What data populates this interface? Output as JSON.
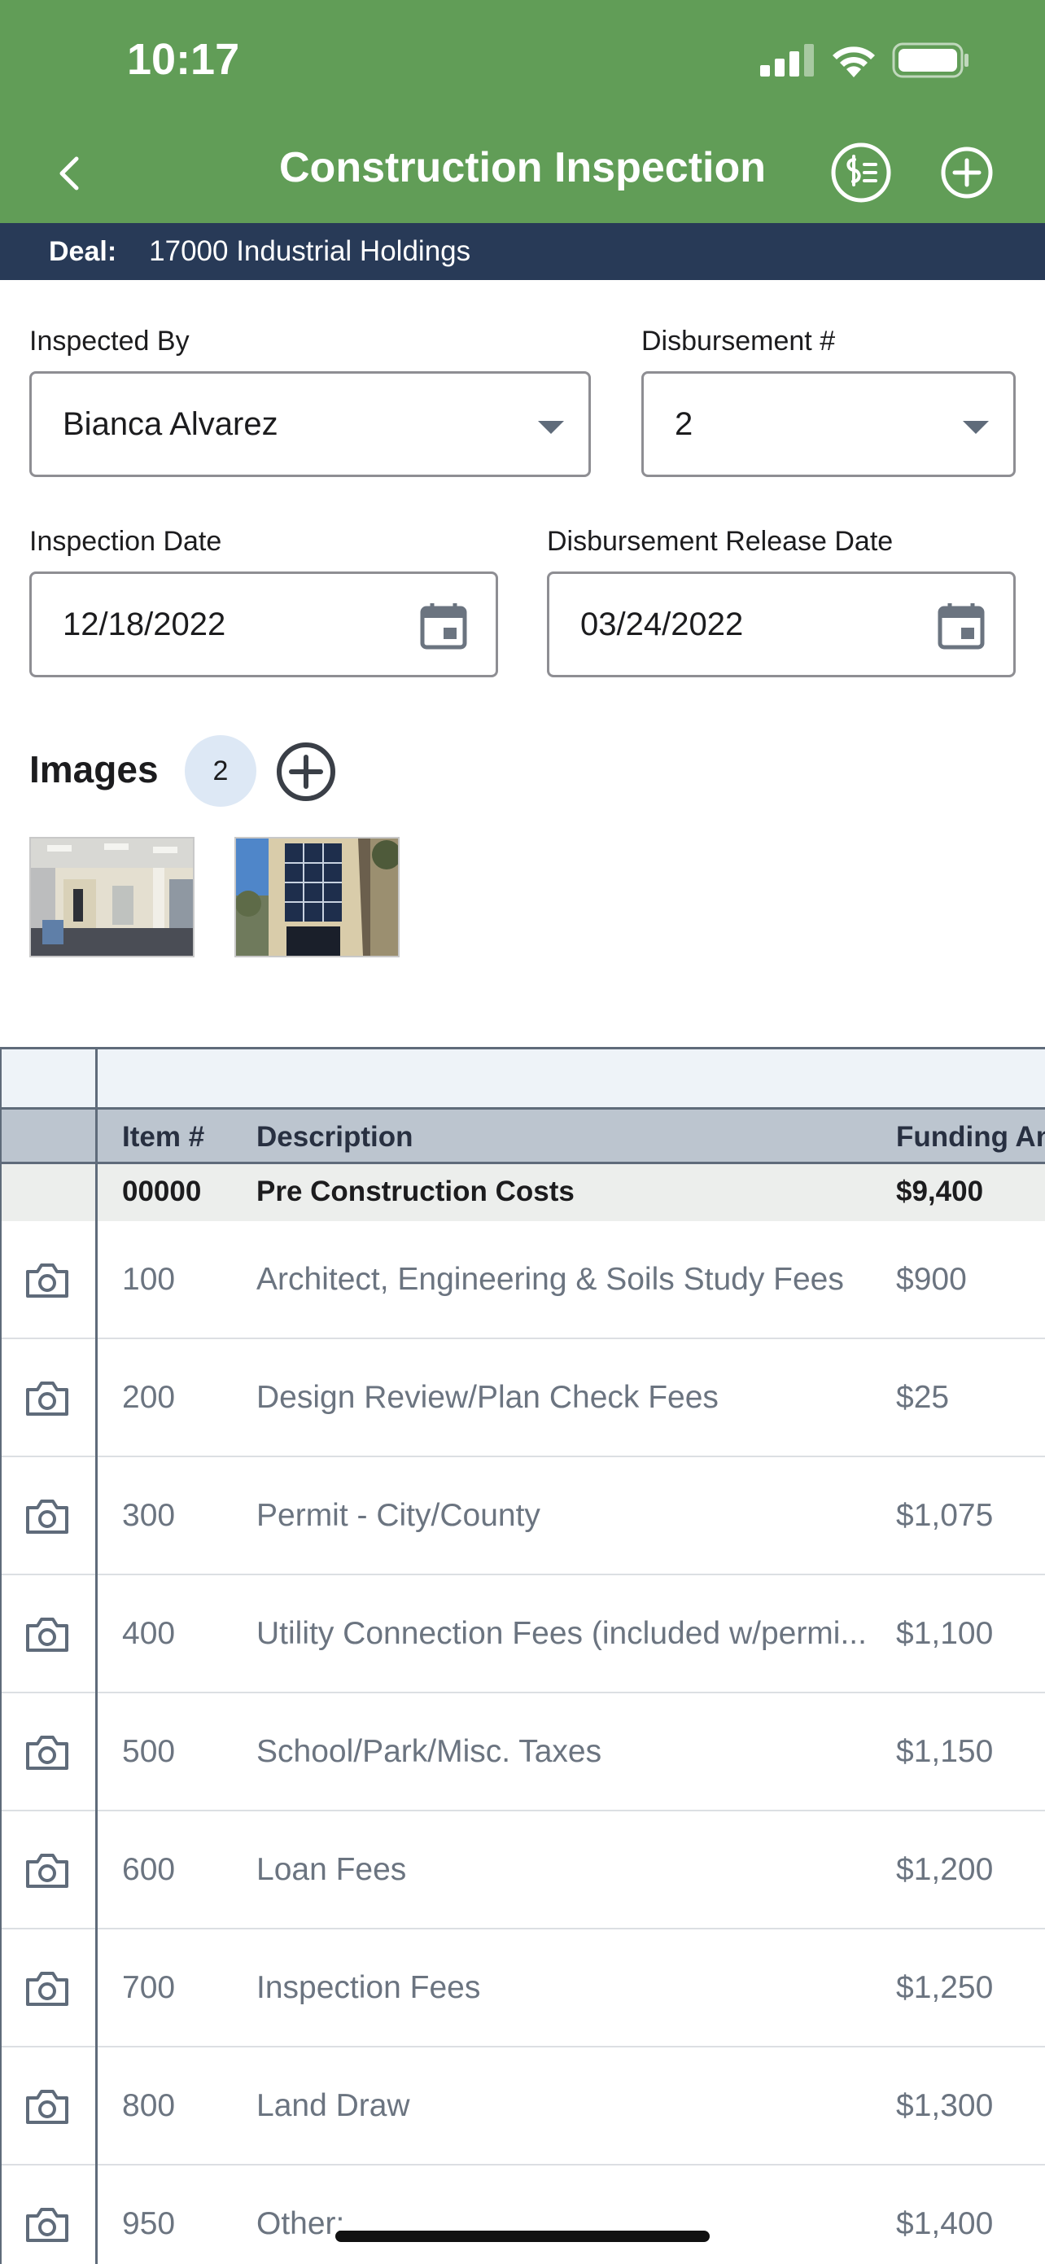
{
  "status_bar": {
    "time": "10:17"
  },
  "nav": {
    "title": "Construction Inspection"
  },
  "deal": {
    "label": "Deal:",
    "value": "17000 Industrial Holdings"
  },
  "form": {
    "inspected_by": {
      "label": "Inspected By",
      "value": "Bianca Alvarez"
    },
    "disbursement_number": {
      "label": "Disbursement #",
      "value": "2"
    },
    "inspection_date": {
      "label": "Inspection Date",
      "value": "12/18/2022"
    },
    "release_date": {
      "label": "Disbursement Release Date",
      "value": "03/24/2022"
    }
  },
  "images": {
    "title": "Images",
    "count": "2"
  },
  "table": {
    "headers": {
      "item": "Item #",
      "description": "Description",
      "funding": "Funding An"
    },
    "group": {
      "item": "00000",
      "description": "Pre Construction Costs",
      "funding": "$9,400"
    },
    "rows": [
      {
        "item": "100",
        "description": "Architect, Engineering & Soils Study Fees",
        "funding": "$900"
      },
      {
        "item": "200",
        "description": "Design Review/Plan Check Fees",
        "funding": "$25"
      },
      {
        "item": "300",
        "description": "Permit - City/County",
        "funding": "$1,075"
      },
      {
        "item": "400",
        "description": "Utility Connection Fees (included w/permi...",
        "funding": "$1,100"
      },
      {
        "item": "500",
        "description": "School/Park/Misc. Taxes",
        "funding": "$1,150"
      },
      {
        "item": "600",
        "description": "Loan Fees",
        "funding": "$1,200"
      },
      {
        "item": "700",
        "description": "Inspection Fees",
        "funding": "$1,250"
      },
      {
        "item": "800",
        "description": "Land Draw",
        "funding": "$1,300"
      },
      {
        "item": "950",
        "description": "Other:",
        "funding": "$1,400"
      }
    ]
  },
  "colors": {
    "header_green": "#619d57",
    "deal_bar": "#283a57",
    "table_header": "#bcc5cf"
  }
}
